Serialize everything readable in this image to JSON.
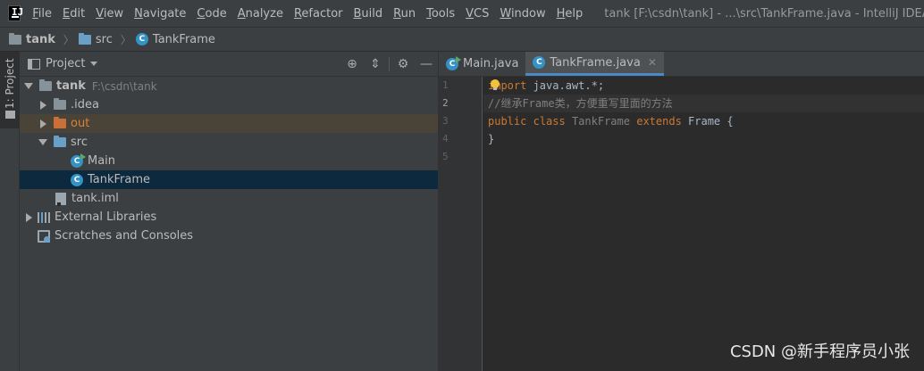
{
  "menubar": {
    "logo_text": "IJ",
    "items": [
      "File",
      "Edit",
      "View",
      "Navigate",
      "Code",
      "Analyze",
      "Refactor",
      "Build",
      "Run",
      "Tools",
      "VCS",
      "Window",
      "Help"
    ],
    "window_title": "tank [F:\\csdn\\tank] - ...\\src\\TankFrame.java - IntelliJ IDEA (Administrator)"
  },
  "breadcrumb": {
    "items": [
      "tank",
      "src",
      "TankFrame"
    ]
  },
  "tool_stripe": {
    "project_tab_label": "1: Project"
  },
  "project_panel": {
    "title": "Project",
    "tree": {
      "root_label": "tank",
      "root_path": "F:\\csdn\\tank",
      "idea_label": ".idea",
      "out_label": "out",
      "src_label": "src",
      "main_label": "Main",
      "tankframe_label": "TankFrame",
      "iml_label": "tank.iml",
      "libraries_label": "External Libraries",
      "scratches_label": "Scratches and Consoles"
    }
  },
  "editor": {
    "tabs": [
      {
        "label": "Main.java",
        "active": false
      },
      {
        "label": "TankFrame.java",
        "active": true
      }
    ],
    "line_numbers": [
      "1",
      "2",
      "3",
      "4",
      "5"
    ],
    "code": {
      "line1_kw": "import",
      "line1_rest": " java.awt.*;",
      "line2_comment": "//继承Frame类，方便重写里面的方法",
      "line3_kw1": "public",
      "line3_kw2": "class",
      "line3_name": "TankFrame",
      "line3_kw3": "extends",
      "line3_super": "Frame",
      "line3_brace": " {",
      "line4": "}"
    }
  },
  "watermark": "CSDN @新手程序员小张",
  "colors": {
    "background": "#2b2b2b",
    "panel": "#3c3f41",
    "selection": "#0d293e",
    "keyword": "#cc7832",
    "comment": "#808080",
    "accent": "#4a88c7"
  }
}
